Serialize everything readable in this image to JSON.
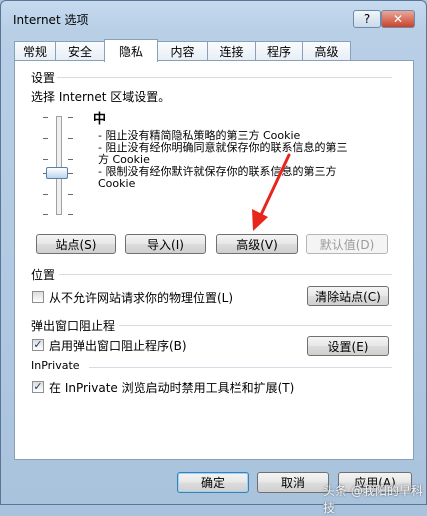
{
  "window": {
    "title": "Internet 选项",
    "help_glyph": "?",
    "close_glyph": "✕"
  },
  "tabs": [
    "常规",
    "安全",
    "隐私",
    "内容",
    "连接",
    "程序",
    "高级"
  ],
  "settings": {
    "group_label": "设置",
    "zone_prompt": "选择 Internet 区域设置。",
    "level": "中",
    "desc_lines": [
      "- 阻止没有精简隐私策略的第三方 Cookie",
      "- 阻止没有经你明确同意就保存你的联系信息的第三",
      "方 Cookie",
      "- 限制没有经你默许就保存你的联系信息的第三方",
      "Cookie"
    ],
    "buttons": {
      "sites": "站点(S)",
      "import": "导入(I)",
      "advanced": "高级(V)",
      "default": "默认值(D)"
    }
  },
  "location": {
    "group_label": "位置",
    "checkbox_label": "从不允许网站请求你的物理位置(L)",
    "checked": false,
    "clear_button": "清除站点(C)"
  },
  "popup": {
    "group_label": "弹出窗口阻止程",
    "checkbox_label": "启用弹出窗口阻止程序(B)",
    "checked": true,
    "settings_button": "设置(E)"
  },
  "inprivate": {
    "group_label": "InPrivate",
    "checkbox_label": "在 InPrivate 浏览启动时禁用工具栏和扩展(T)",
    "checked": true
  },
  "footer": {
    "ok": "确定",
    "cancel": "取消",
    "apply": "应用(A)"
  },
  "watermark": "头条 @我阳的早科技",
  "colors": {
    "annotation_arrow": "#e8251c"
  }
}
